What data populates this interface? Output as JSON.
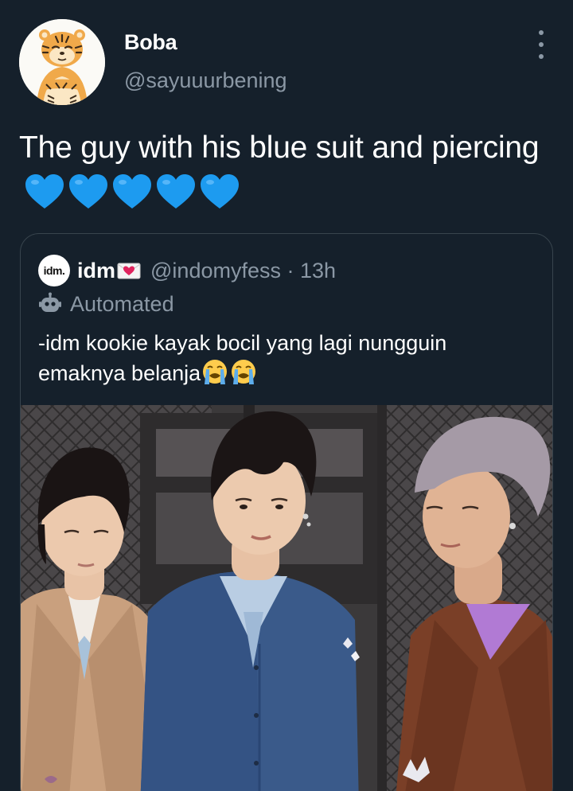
{
  "author": {
    "display_name": "Boba",
    "handle": "@sayuuurbening",
    "avatar_icon": "tiger-avatar"
  },
  "tweet": {
    "text": "The guy with his blue suit and piercing",
    "emoji": [
      "blue-heart",
      "blue-heart",
      "blue-heart",
      "blue-heart",
      "blue-heart"
    ]
  },
  "quoted_tweet": {
    "avatar_text": "idm.",
    "display_name": "idm",
    "name_emoji": "envelope-with-heart",
    "handle_and_time": "@indomyfess · 13h",
    "automated_label": "Automated",
    "text": "-idm kookie kayak bocil yang lagi nungguin emaknya belanja",
    "text_emoji": [
      "loudly-crying-face",
      "loudly-crying-face"
    ]
  },
  "colors": {
    "background": "#15202b",
    "secondary_text": "#8b98a5",
    "border": "#38444d",
    "heart": "#1d9bf0"
  }
}
